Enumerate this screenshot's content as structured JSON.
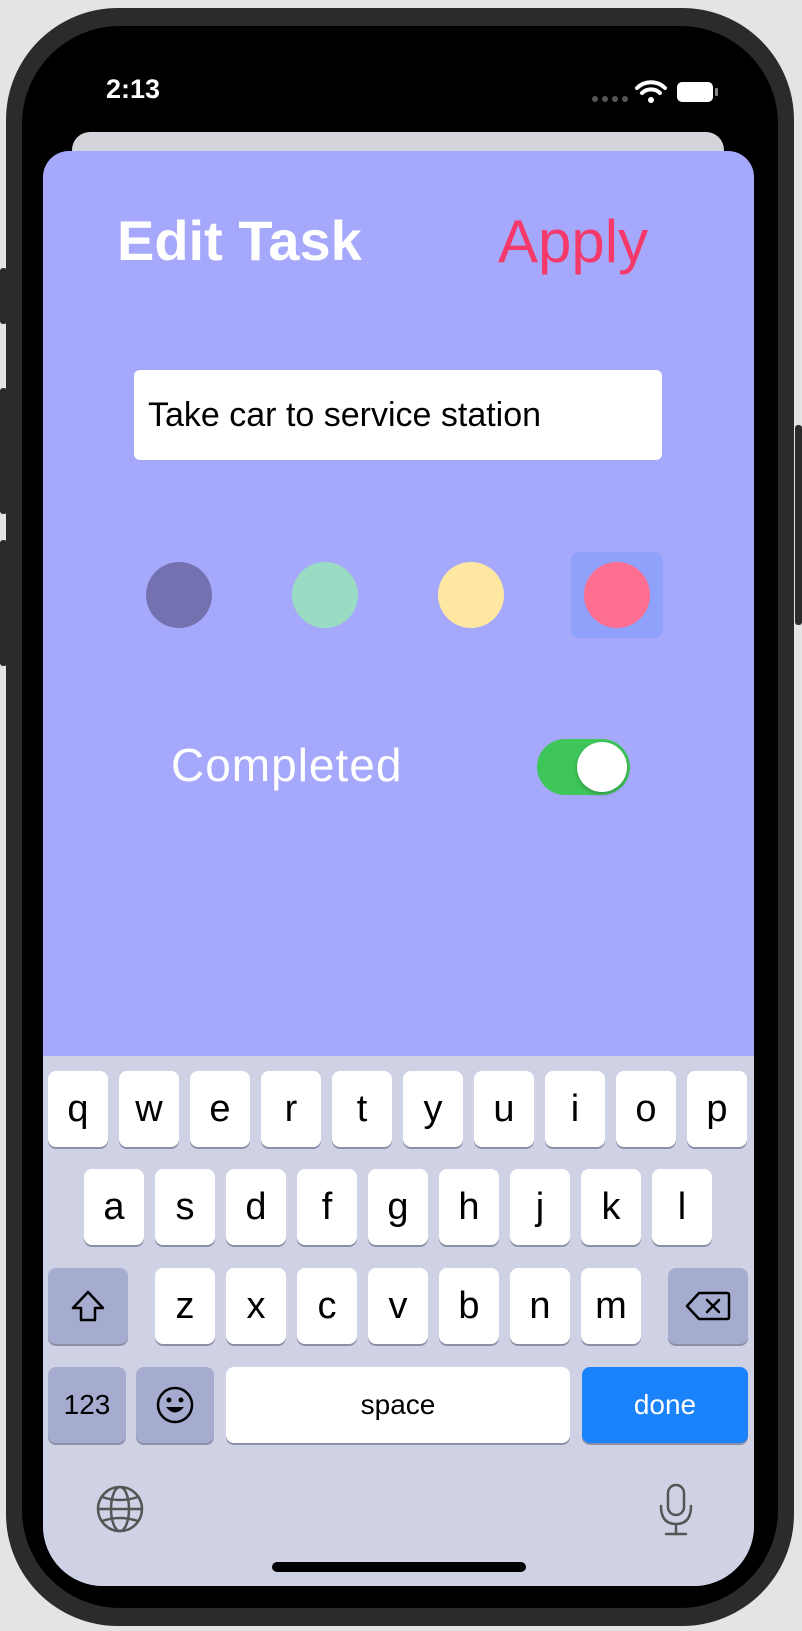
{
  "status_bar": {
    "time": "2:13",
    "signal_icon": "signal-dots-icon",
    "wifi_icon": "wifi-icon",
    "battery_icon": "battery-icon"
  },
  "header": {
    "title": "Edit Task",
    "apply_label": "Apply"
  },
  "task": {
    "value": "Take car to service station"
  },
  "colors": {
    "background": "#a6a8fb",
    "accent": "#f53a6b",
    "swatches": [
      "#7471b0",
      "#99dbc3",
      "#fde7a1",
      "#fe6e91"
    ],
    "selected_index": 3,
    "selected_highlight": "#8fa1fb",
    "toggle_on": "#3fc65a",
    "done_key": "#1a82fb"
  },
  "completed": {
    "label": "Completed",
    "value": true
  },
  "keyboard": {
    "row1": [
      "q",
      "w",
      "e",
      "r",
      "t",
      "y",
      "u",
      "i",
      "o",
      "p"
    ],
    "row2": [
      "a",
      "s",
      "d",
      "f",
      "g",
      "h",
      "j",
      "k",
      "l"
    ],
    "row3": [
      "z",
      "x",
      "c",
      "v",
      "b",
      "n",
      "m"
    ],
    "shift_icon": "shift-icon",
    "delete_icon": "backspace-icon",
    "numbers_label": "123",
    "emoji_icon": "emoji-icon",
    "space_label": "space",
    "done_label": "done",
    "globe_icon": "globe-icon",
    "mic_icon": "microphone-icon"
  }
}
